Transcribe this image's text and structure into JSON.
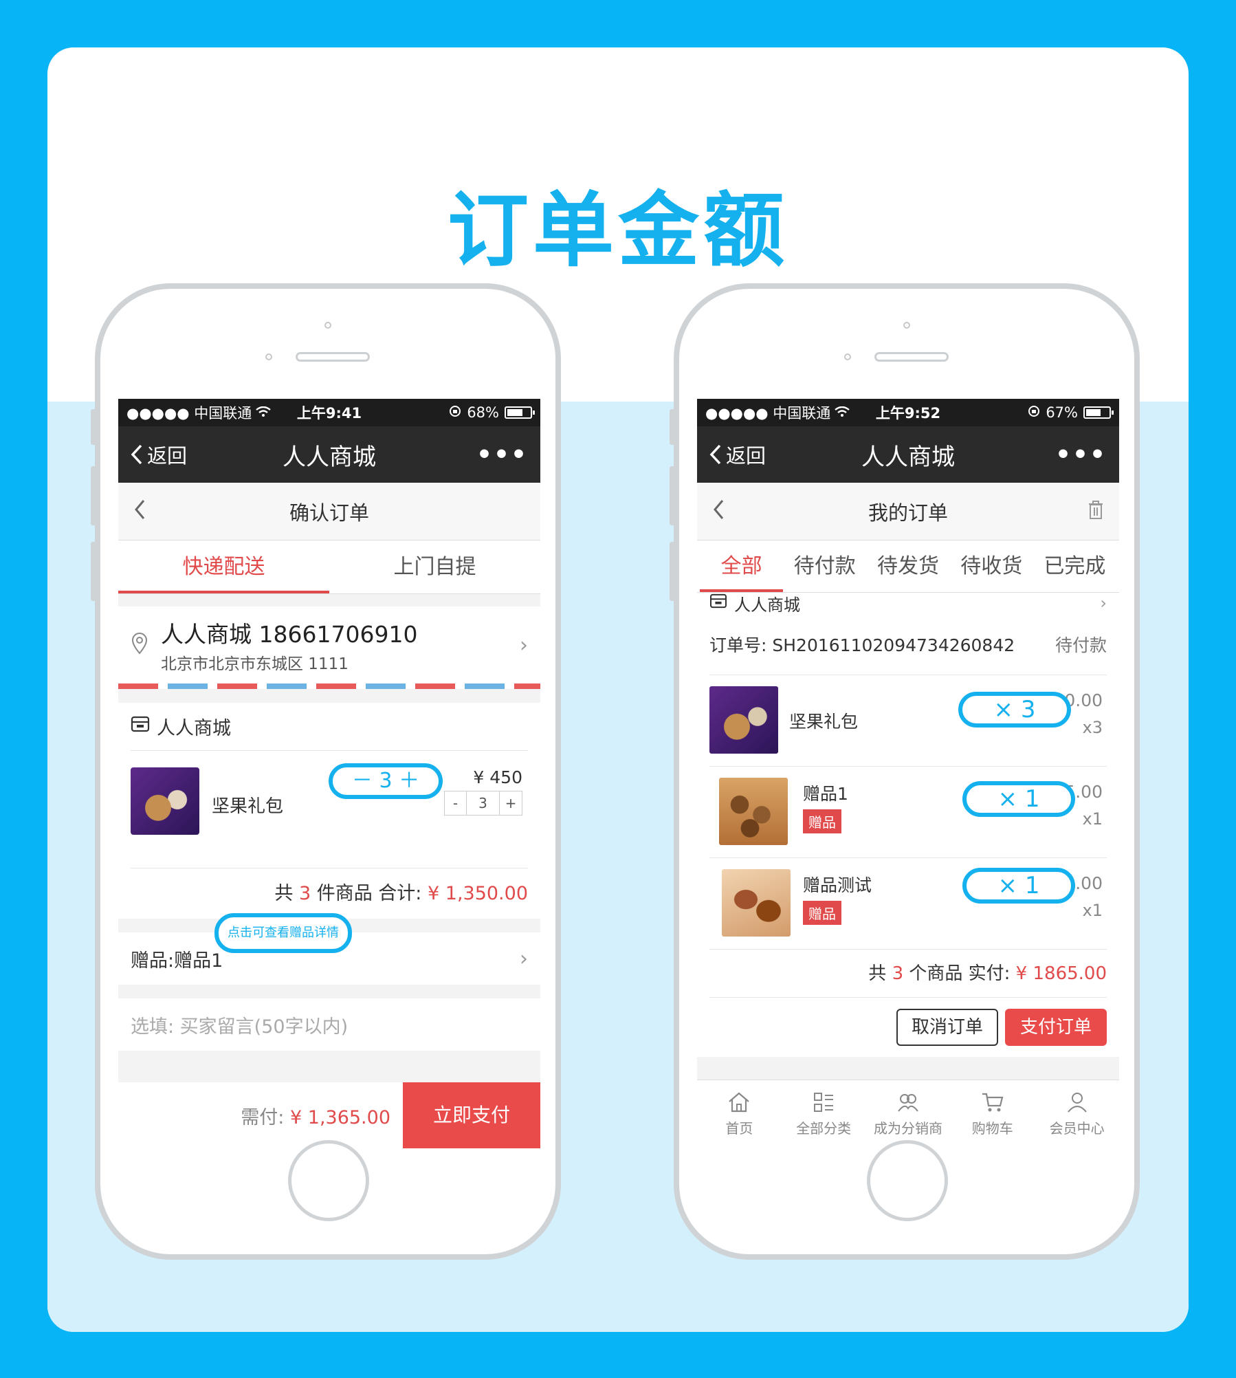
{
  "headline": "订单金额",
  "colors": {
    "accent_blue": "#14b1ee",
    "red": "#e14a4a",
    "dark_bar": "#2b2b2b"
  },
  "left_phone": {
    "status": {
      "carrier": "●●●●● 中国联通",
      "time": "上午9:41",
      "battery": "68%",
      "battery_level": 0.68
    },
    "nav": {
      "back": "返回",
      "title": "人人商城",
      "more": "•••"
    },
    "page_title": "确认订单",
    "tabs": [
      "快递配送",
      "上门自提"
    ],
    "address": {
      "name_phone": "人人商城 18661706910",
      "line": "北京市北京市东城区 1111"
    },
    "shop": "人人商城",
    "product": {
      "name": "坚果礼包",
      "price": "¥ 450",
      "minus": "-",
      "qty": "3",
      "plus": "+"
    },
    "summary": {
      "prefix": "共 ",
      "count": "3",
      "mid": " 件商品 合计: ",
      "total": "¥ 1,350.00"
    },
    "gift": {
      "label": "赠品: ",
      "value": "赠品1"
    },
    "note_placeholder": "选填: 买家留言(50字以内)",
    "pay": {
      "due_label": "需付: ",
      "due_value": "¥ 1,365.00",
      "button": "立即支付"
    },
    "callout_qty": "－ 3 ＋",
    "callout_tip": "点击可查看赠品详情"
  },
  "right_phone": {
    "status": {
      "carrier": "●●●●● 中国联通",
      "time": "上午9:52",
      "battery": "67%",
      "battery_level": 0.67
    },
    "nav": {
      "back": "返回",
      "title": "人人商城",
      "more": "•••"
    },
    "page_title": "我的订单",
    "tabs": [
      "全部",
      "待付款",
      "待发货",
      "待收货",
      "已完成"
    ],
    "shop": "人人商城",
    "order_no": "订单号: SH20161102094734260842",
    "order_status": "待付款",
    "items": [
      {
        "name": "坚果礼包",
        "tag": "",
        "price": "¥ 450.00",
        "qty": "x3"
      },
      {
        "name": "赠品1",
        "tag": "赠品",
        "price": "¥ 5.00",
        "qty": "x1"
      },
      {
        "name": "赠品测试",
        "tag": "赠品",
        "price": "¥ 10.00",
        "qty": "x1"
      }
    ],
    "summary": {
      "prefix": "共 ",
      "count": "3",
      "mid": " 个商品 实付: ",
      "total": "¥ 1865.00"
    },
    "buttons": {
      "cancel": "取消订单",
      "pay": "支付订单"
    },
    "bottom_nav": [
      "首页",
      "全部分类",
      "成为分销商",
      "购物车",
      "会员中心"
    ],
    "callouts": [
      "× 3",
      "× 1",
      "× 1"
    ]
  }
}
